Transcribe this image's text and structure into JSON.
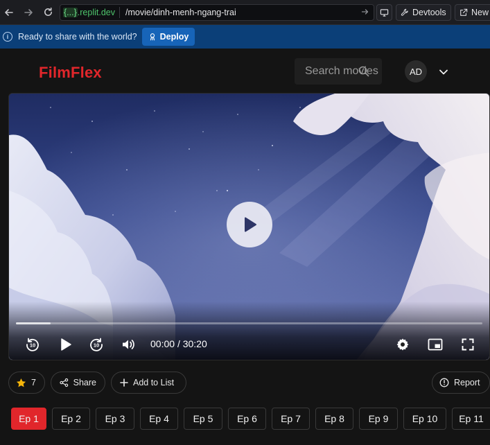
{
  "browser": {
    "domain_token": "{...}",
    "domain_suffix": ".replit.dev",
    "path": "/movie/dinh-menh-ngang-trai",
    "devtools_label": "Devtools",
    "new_label": "New"
  },
  "banner": {
    "message": "Ready to share with the world?",
    "deploy_label": "Deploy"
  },
  "site": {
    "logo": "FilmFlex",
    "search_placeholder": "Search movies",
    "avatar_initials": "AD"
  },
  "player": {
    "current_time": "00:00",
    "separator": "/",
    "duration": "30:20",
    "progress_fraction": 0.0,
    "buffered_fraction": 0.074,
    "skip_back_seconds": "10",
    "skip_forward_seconds": "10"
  },
  "actions": {
    "rating": "7",
    "share_label": "Share",
    "add_to_list_label": "Add to List",
    "report_label": "Report"
  },
  "episodes": [
    "Ep 1",
    "Ep 2",
    "Ep 3",
    "Ep 4",
    "Ep 5",
    "Ep 6",
    "Ep 7",
    "Ep 8",
    "Ep 9",
    "Ep 10",
    "Ep 11"
  ],
  "active_episode": "Ep 1",
  "colors": {
    "brand": "#e1262b",
    "banner": "#0b3f78",
    "deploy_button": "#1764b8",
    "star": "#f5b50a"
  }
}
